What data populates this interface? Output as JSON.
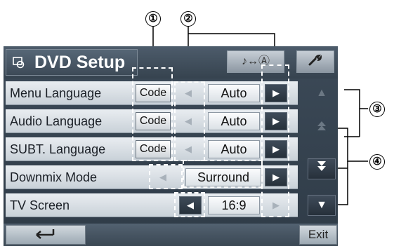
{
  "callouts": [
    "①",
    "②",
    "③",
    "④"
  ],
  "header": {
    "title": "DVD Setup",
    "title_icon": "disc-settings-icon",
    "audio_toggle_label": "♪↔Ⓐ",
    "wrench_symbol": "🔧"
  },
  "rows": [
    {
      "label": "Menu Language",
      "code": "Code",
      "value": "Auto"
    },
    {
      "label": "Audio Language",
      "code": "Code",
      "value": "Auto"
    },
    {
      "label": "SUBT. Language",
      "code": "Code",
      "value": "Auto"
    },
    {
      "label": "Downmix Mode",
      "value": "Surround"
    },
    {
      "label": "TV Screen",
      "value": "16:9"
    }
  ],
  "arrows": {
    "left": "◀",
    "right": "▶",
    "up": "▲",
    "down": "▼"
  },
  "footer": {
    "back_symbol": "⮌",
    "exit_label": "Exit"
  }
}
